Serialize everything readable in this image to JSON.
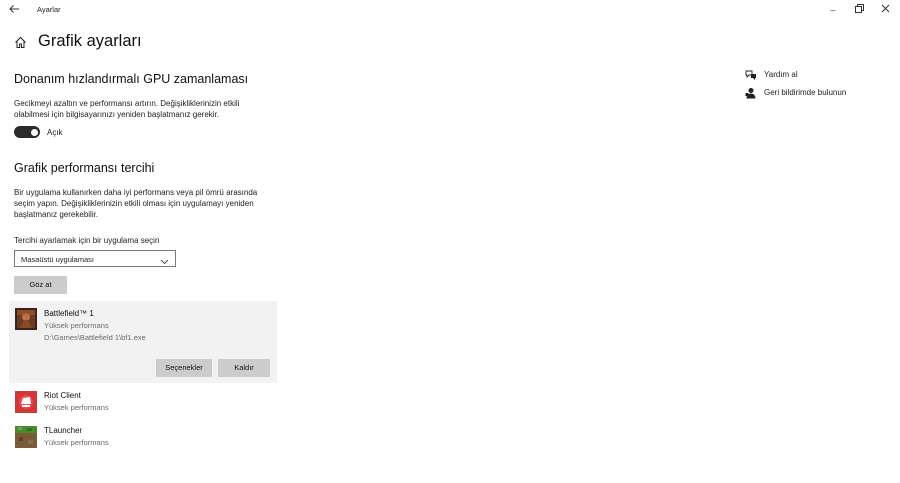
{
  "window": {
    "title": "Ayarlar",
    "back_icon": "back-arrow-icon",
    "minimize_glyph": "–",
    "maximize_glyph": "❐",
    "close_glyph": "✕"
  },
  "header": {
    "title": "Grafik ayarları",
    "home_icon": "home-icon"
  },
  "gpu_scheduling": {
    "heading": "Donanım hızlandırmalı GPU zamanlaması",
    "description_line1": "Gecikmeyi azaltın ve performansı artırın. Değişikliklerinizin etkili",
    "description_line2": "olabilmesi için bilgisayarınızı yeniden başlatmanız gerekir.",
    "toggle_state": "Açık",
    "toggle_on": true
  },
  "graphics_pref": {
    "heading": "Grafik performansı tercihi",
    "description_line1": "Bir uygulama kullanırken daha iyi performans veya pil ömrü arasında",
    "description_line2": "seçim yapın. Değişikliklerinizin etkili olması için uygulamayı yeniden",
    "description_line3": "başlatmanız gerekebilir.",
    "select_label": "Tercihi ayarlamak için bir uygulama seçin",
    "select_value": "Masaüstü uygulaması",
    "browse_button": "Göz at"
  },
  "apps": [
    {
      "name": "Battlefield™ 1",
      "preference": "Yüksek performans",
      "path": "D:\\Games\\Battlefield 1\\bf1.exe",
      "options_button": "Seçenekler",
      "remove_button": "Kaldır",
      "selected": true
    },
    {
      "name": "Riot Client",
      "preference": "Yüksek performans"
    },
    {
      "name": "TLauncher",
      "preference": "Yüksek performans"
    }
  ],
  "side": {
    "help": "Yardım al",
    "feedback": "Geri bildirimde bulunun"
  }
}
